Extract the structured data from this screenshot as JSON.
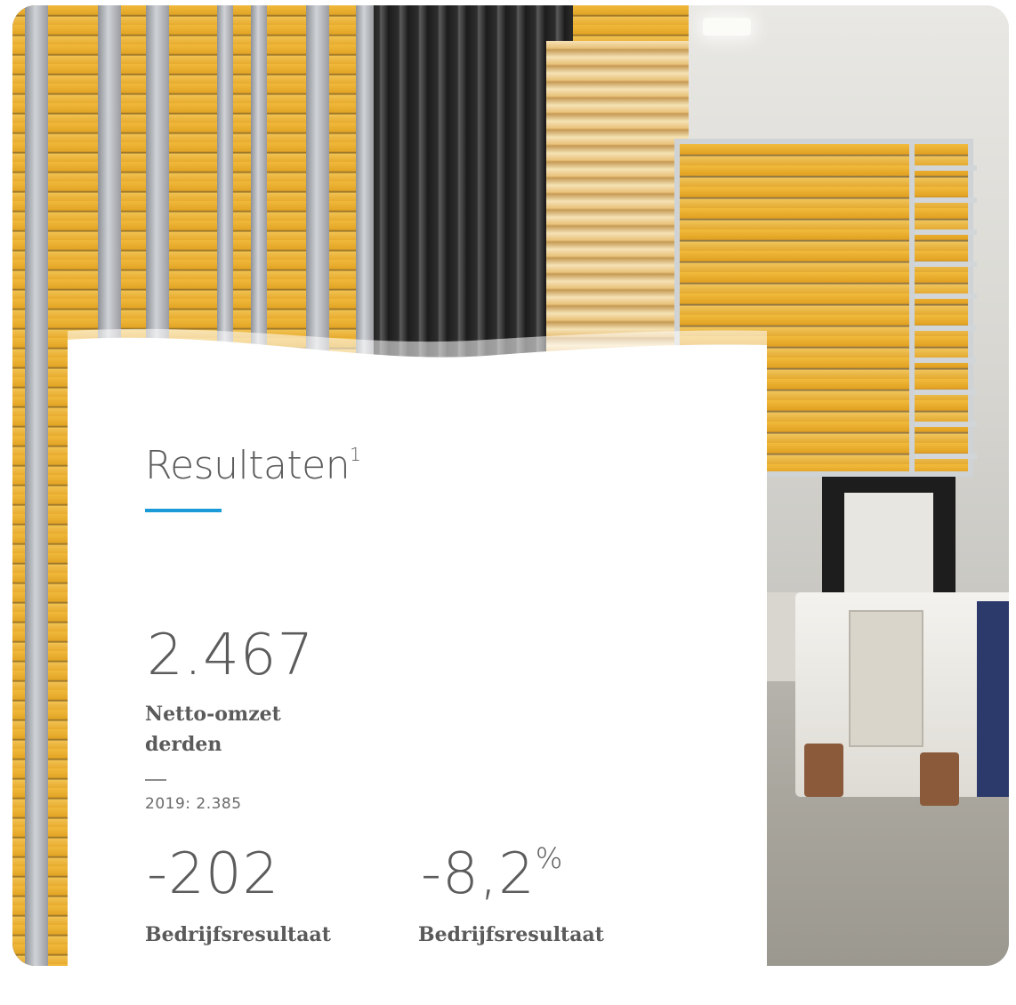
{
  "hero_image": {
    "description_icon": "cheese-warehouse-photo-icon"
  },
  "section": {
    "title": "Resultaten",
    "title_footnote": "1",
    "accent_color": "#1a9ad6"
  },
  "metrics": {
    "revenue": {
      "value": "2.467",
      "label_line1": "Netto-omzet",
      "label_line2": "derden",
      "previous": "2019: 2.385"
    },
    "operating_result": {
      "value": "-202",
      "label": "Bedrijfsresultaat"
    },
    "operating_margin": {
      "value": "-8,2",
      "unit": "%",
      "label": "Bedrijfsresultaat"
    }
  }
}
